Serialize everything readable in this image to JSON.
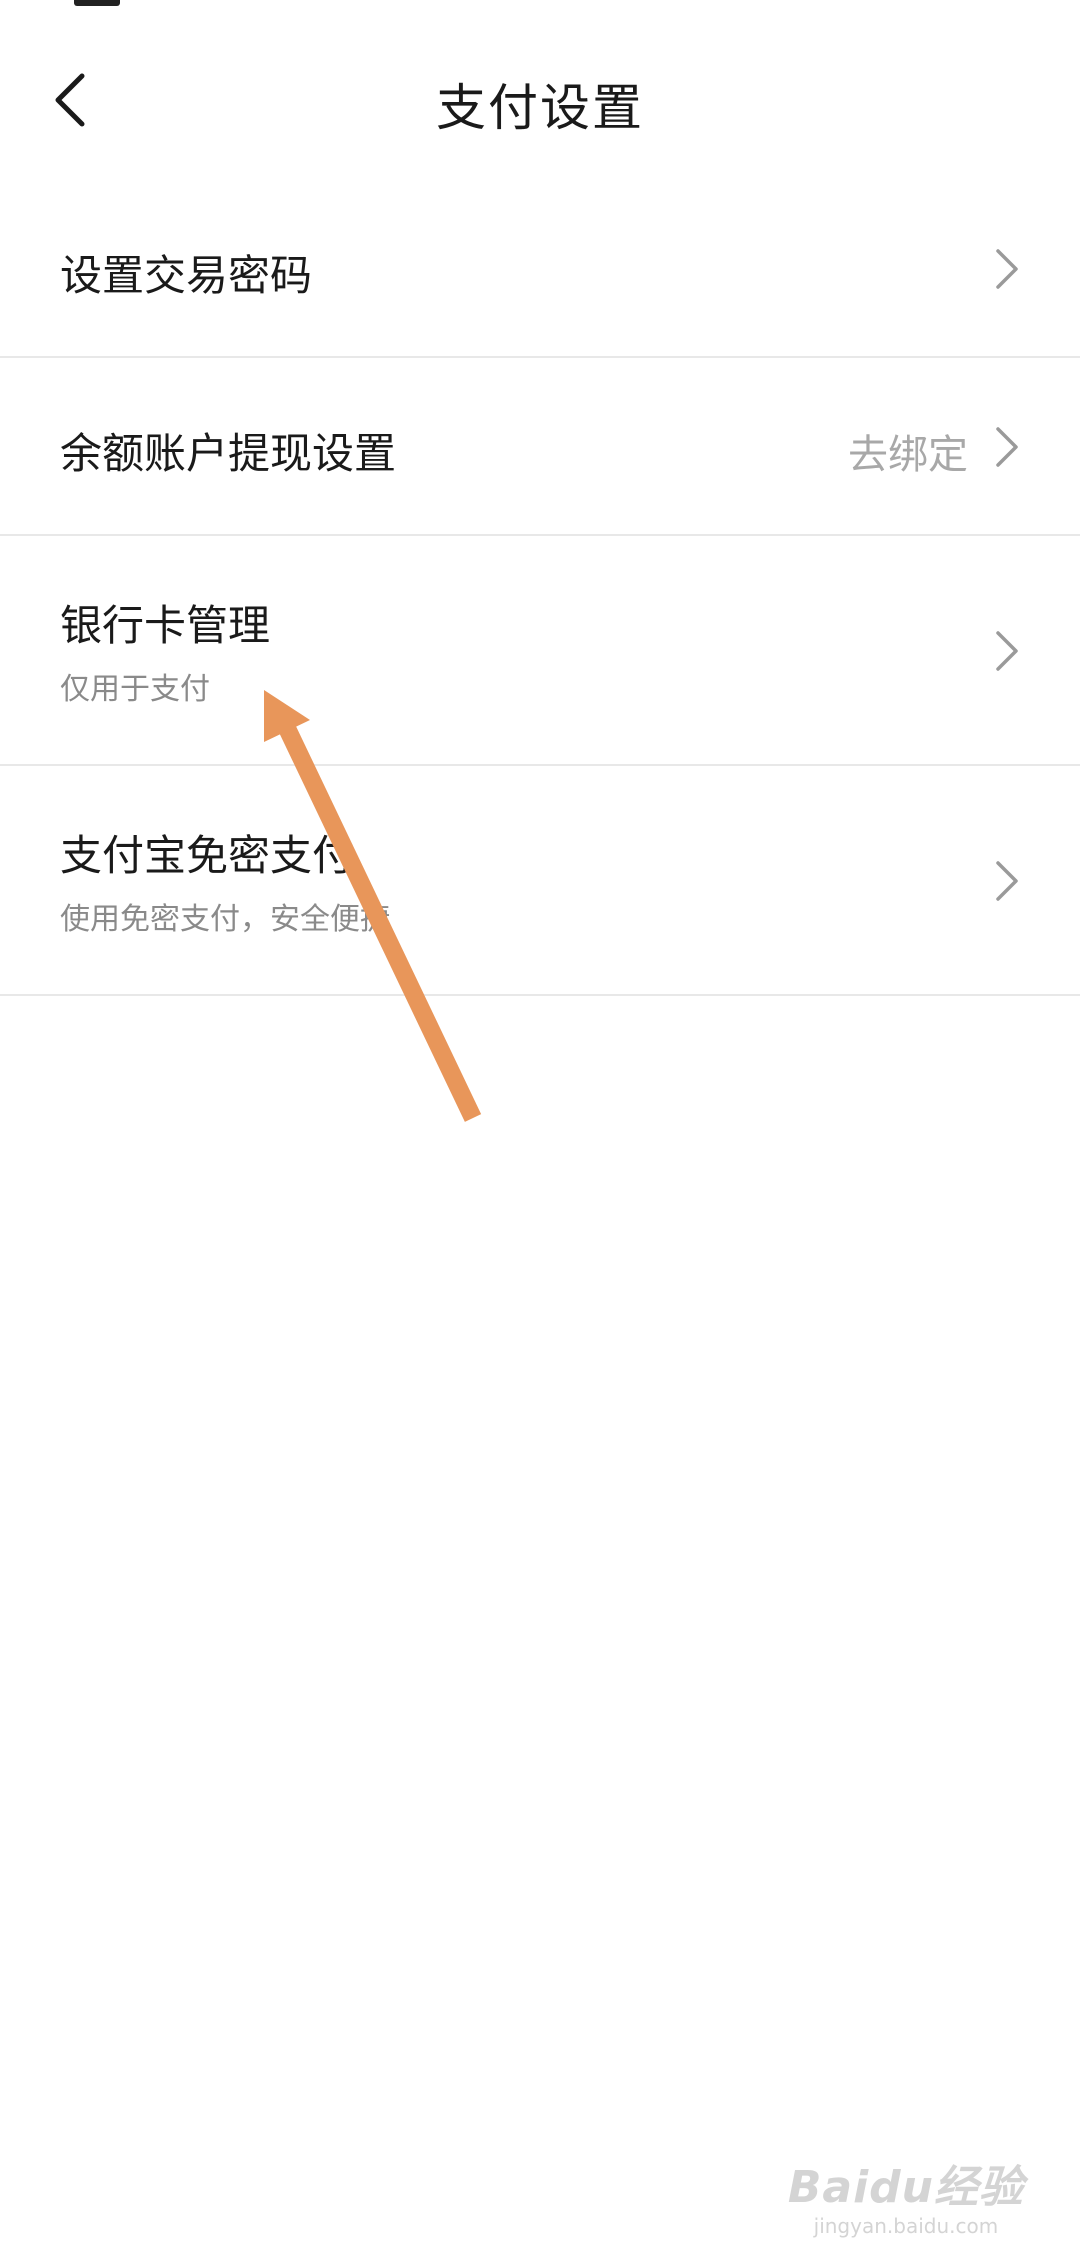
{
  "header": {
    "title": "支付设置"
  },
  "settings": {
    "items": [
      {
        "title": "设置交易密码"
      },
      {
        "title": "余额账户提现设置",
        "value": "去绑定"
      },
      {
        "title": "银行卡管理",
        "subtitle": "仅用于支付"
      },
      {
        "title": "支付宝免密支付",
        "subtitle": "使用免密支付，安全便捷"
      }
    ]
  },
  "annotation": {
    "arrow_color": "#E8965A"
  },
  "watermark": {
    "logo": "Baidu经验",
    "url": "jingyan.baidu.com"
  }
}
